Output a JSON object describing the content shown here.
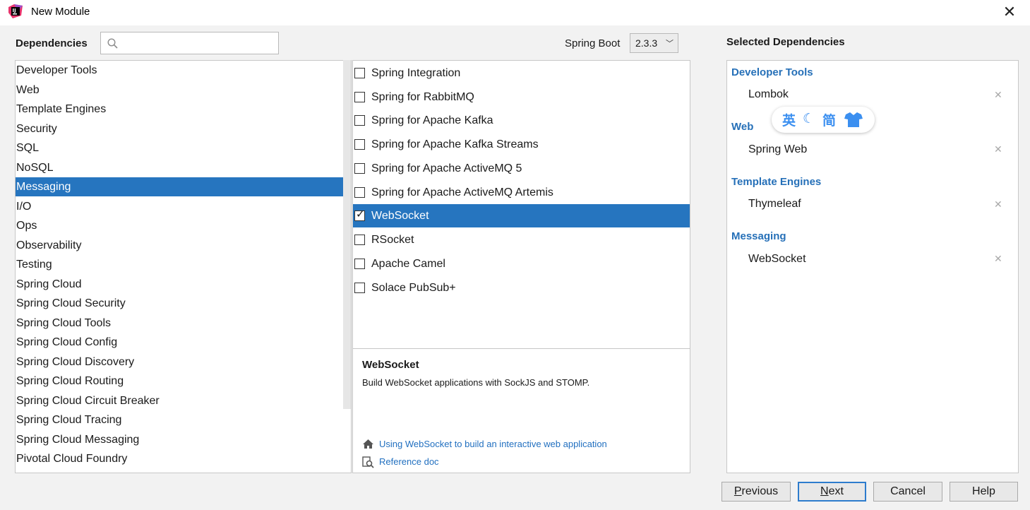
{
  "window": {
    "title": "New Module"
  },
  "header": {
    "dependencies_label": "Dependencies",
    "search_value": "",
    "spring_boot_label": "Spring Boot",
    "spring_boot_version": "2.3.3",
    "selected_title": "Selected Dependencies"
  },
  "categories": [
    "Developer Tools",
    "Web",
    "Template Engines",
    "Security",
    "SQL",
    "NoSQL",
    "Messaging",
    "I/O",
    "Ops",
    "Observability",
    "Testing",
    "Spring Cloud",
    "Spring Cloud Security",
    "Spring Cloud Tools",
    "Spring Cloud Config",
    "Spring Cloud Discovery",
    "Spring Cloud Routing",
    "Spring Cloud Circuit Breaker",
    "Spring Cloud Tracing",
    "Spring Cloud Messaging",
    "Pivotal Cloud Foundry"
  ],
  "selected_category": "Messaging",
  "dependencies": [
    {
      "label": "Spring Integration",
      "checked": false
    },
    {
      "label": "Spring for RabbitMQ",
      "checked": false
    },
    {
      "label": "Spring for Apache Kafka",
      "checked": false
    },
    {
      "label": "Spring for Apache Kafka Streams",
      "checked": false
    },
    {
      "label": "Spring for Apache ActiveMQ 5",
      "checked": false
    },
    {
      "label": "Spring for Apache ActiveMQ Artemis",
      "checked": false
    },
    {
      "label": "WebSocket",
      "checked": true
    },
    {
      "label": "RSocket",
      "checked": false
    },
    {
      "label": "Apache Camel",
      "checked": false
    },
    {
      "label": "Solace PubSub+",
      "checked": false
    }
  ],
  "selected_dependency": "WebSocket",
  "description": {
    "title": "WebSocket",
    "text": "Build WebSocket applications with SockJS and STOMP.",
    "guide_link": "Using WebSocket to build an interactive web application",
    "reference_link": "Reference doc"
  },
  "selected_groups": [
    {
      "title": "Developer Tools",
      "items": [
        "Lombok"
      ]
    },
    {
      "title": "Web",
      "items": [
        "Spring Web"
      ]
    },
    {
      "title": "Template Engines",
      "items": [
        "Thymeleaf"
      ]
    },
    {
      "title": "Messaging",
      "items": [
        "WebSocket"
      ]
    }
  ],
  "ime_toolbar": {
    "lang": "英",
    "moon": "☾",
    "script": "简",
    "shirt": "shirt-icon"
  },
  "buttons": {
    "previous_mnemonic": "P",
    "previous_rest": "revious",
    "next_mnemonic": "N",
    "next_rest": "ext",
    "cancel": "Cancel",
    "help": "Help"
  },
  "colors": {
    "selection": "#2675bf",
    "group_title": "#2670b8",
    "link": "#2270c0"
  }
}
